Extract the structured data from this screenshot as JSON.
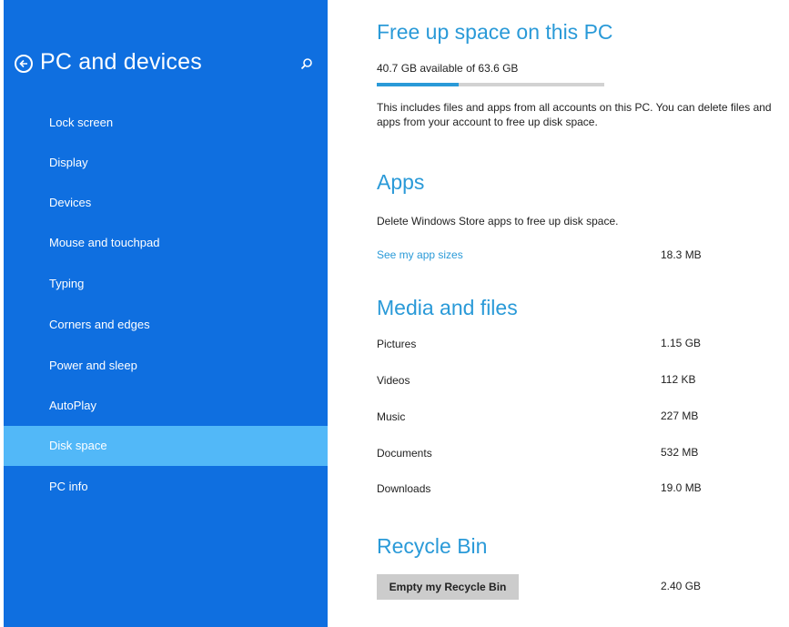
{
  "sidebar": {
    "title": "PC and devices",
    "items": [
      {
        "label": "Lock screen"
      },
      {
        "label": "Display"
      },
      {
        "label": "Devices"
      },
      {
        "label": "Mouse and touchpad"
      },
      {
        "label": "Typing"
      },
      {
        "label": "Corners and edges"
      },
      {
        "label": "Power and sleep"
      },
      {
        "label": "AutoPlay"
      },
      {
        "label": "Disk space",
        "selected": true
      },
      {
        "label": "PC info"
      }
    ],
    "icons": {
      "back": "back-arrow-icon",
      "search": "search-icon"
    },
    "colors": {
      "background": "#0f6fe0",
      "selected": "#52b8f8"
    }
  },
  "main": {
    "title": "Free up space on this PC",
    "storage": {
      "summary": "40.7 GB available of 63.6 GB",
      "used_fraction": 0.36
    },
    "description": "This includes files and apps from all accounts on this PC. You can delete files and apps from your account to free up disk space.",
    "apps": {
      "title": "Apps",
      "description": "Delete Windows Store apps to free up disk space.",
      "link": "See my app sizes",
      "size": "18.3 MB"
    },
    "media": {
      "title": "Media and files",
      "rows": [
        {
          "label": "Pictures",
          "size": "1.15 GB"
        },
        {
          "label": "Videos",
          "size": "112 KB"
        },
        {
          "label": "Music",
          "size": "227 MB"
        },
        {
          "label": "Documents",
          "size": "532 MB"
        },
        {
          "label": "Downloads",
          "size": "19.0 MB"
        }
      ]
    },
    "recycle": {
      "title": "Recycle Bin",
      "button": "Empty my Recycle Bin",
      "size": "2.40 GB"
    },
    "colors": {
      "accent": "#2a9ad8",
      "button": "#cccccc"
    }
  }
}
